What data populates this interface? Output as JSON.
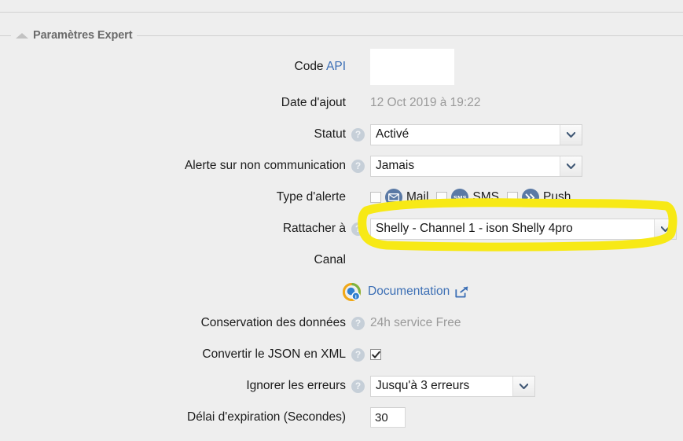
{
  "panel": {
    "title": "Paramètres Expert",
    "collapse_icon": "triangle-up-icon"
  },
  "fields": {
    "code_api": {
      "label_prefix": "Code ",
      "label_link": "API",
      "value": "",
      "placeholder": ""
    },
    "date_ajout": {
      "label": "Date d'ajout",
      "value": "12 Oct 2019 à 19:22"
    },
    "statut": {
      "label": "Statut",
      "value": "Activé",
      "help": "?"
    },
    "alerte_non_communication": {
      "label": "Alerte sur non communication",
      "value": "Jamais",
      "help": "?"
    },
    "type_alerte": {
      "label": "Type d'alerte",
      "options": [
        {
          "label": "Mail",
          "icon": "mail-icon",
          "checked": false
        },
        {
          "label": "SMS",
          "icon": "sms-icon",
          "checked": false
        },
        {
          "label": "Push",
          "icon": "push-icon",
          "checked": false
        }
      ]
    },
    "rattacher_a": {
      "label": "Rattacher à",
      "value": "Shelly - Channel 1 - ison Shelly 4pro",
      "help": "?"
    },
    "canal": {
      "label": "Canal",
      "value": ""
    },
    "documentation": {
      "link_label": "Documentation",
      "icon": "help-globe-icon",
      "external_icon": "external-link-icon"
    },
    "conservation_donnees": {
      "label": "Conservation des données",
      "value": "24h service Free",
      "help": "?"
    },
    "convertir_json_xml": {
      "label": "Convertir le JSON en XML",
      "checked": true,
      "help": "?"
    },
    "ignorer_erreurs": {
      "label": "Ignorer les erreurs",
      "value": "Jusqu'à 3 erreurs",
      "help": "?"
    },
    "delai_expiration": {
      "label": "Délai d'expiration (Secondes)",
      "value": "30"
    }
  },
  "annotation": {
    "type": "yellow-marker-rectangle",
    "color": "#f7e916",
    "target": "rattacher-a-select"
  },
  "colors": {
    "background": "#eeeeee",
    "link": "#3c6fb5",
    "muted_text": "#9a9a9a",
    "legend_text": "#6a6a6a",
    "badge_blue": "#5a79a5",
    "highlight_yellow": "#f7e916"
  }
}
